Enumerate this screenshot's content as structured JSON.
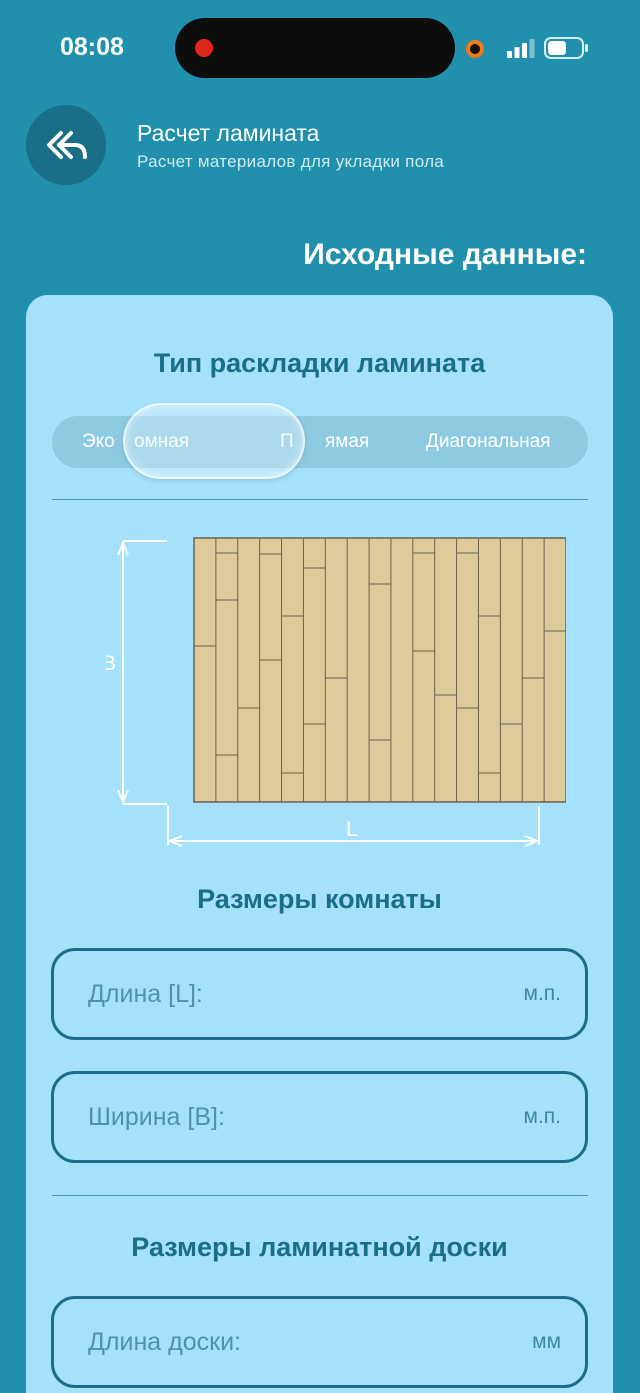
{
  "status_bar": {
    "time": "08:08"
  },
  "header": {
    "title": "Расчет ламината",
    "subtitle": "Расчет материалов для укладки пола"
  },
  "section_heading": "Исходные данные:",
  "layout_type": {
    "title": "Тип раскладки ламината",
    "options": [
      "Экономная",
      "Прямая",
      "Диагональная"
    ],
    "options_visible": [
      "Эко",
      "омная",
      "П",
      "ямая",
      "Диагональная"
    ],
    "selected": "Экономная"
  },
  "diagram": {
    "label_b": "B",
    "label_l": "L"
  },
  "room_size": {
    "title": "Размеры комнаты",
    "length": {
      "label": "Длина [L]:",
      "unit": "м.п."
    },
    "width": {
      "label": "Ширина [B]:",
      "unit": "м.п."
    }
  },
  "board_size": {
    "title": "Размеры ламинатной доски",
    "length": {
      "label": "Длина доски:",
      "unit": "мм"
    }
  },
  "colors": {
    "background": "#2090ad",
    "card": "#a6e1fb",
    "accent": "#1a6e88",
    "board": "#decb9b"
  }
}
